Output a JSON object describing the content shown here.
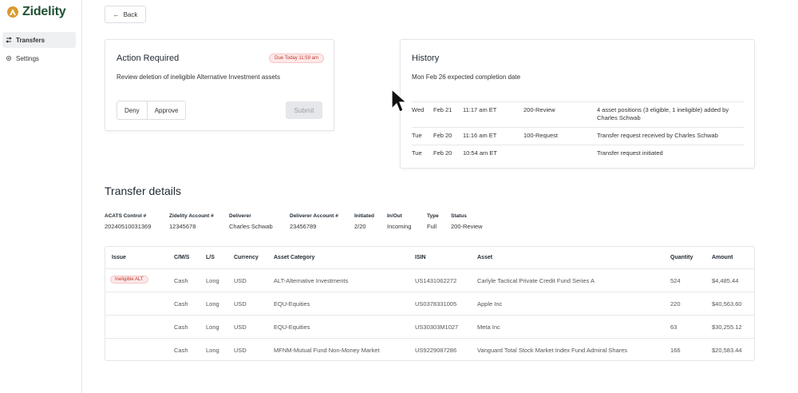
{
  "brand": {
    "name": "Zidelity",
    "color": "#1f5132",
    "accent": "#d99a2b"
  },
  "sidebar": {
    "items": [
      {
        "label": "Transfers",
        "icon": "transfers-icon",
        "active": true
      },
      {
        "label": "Settings",
        "icon": "gear-icon",
        "active": false
      }
    ]
  },
  "back": {
    "label": "Back"
  },
  "action": {
    "title": "Action Required",
    "due": "Due Today 11:59 am",
    "description": "Review deletion of ineligible Alternative Investment assets",
    "deny": "Deny",
    "approve": "Approve",
    "submit": "Submit"
  },
  "history": {
    "title": "History",
    "subtitle": "Mon Feb 26 expected completion date",
    "rows": [
      {
        "day": "Wed",
        "date": "Feb 21",
        "time": "11:17 am ET",
        "status": "200-Review",
        "desc": "4 asset positions (3 eligible, 1 ineligible) added by Charles Schwab"
      },
      {
        "day": "Tue",
        "date": "Feb 20",
        "time": "11:16 am ET",
        "status": "100-Request",
        "desc": "Transfer request received by Charles Schwab"
      },
      {
        "day": "Tue",
        "date": "Feb 20",
        "time": "10:54 am ET",
        "status": "",
        "desc": "Transfer request initiated"
      }
    ]
  },
  "details": {
    "title": "Transfer details",
    "fields": [
      {
        "key": "ACATS Control #",
        "value": "2024051003136​9"
      },
      {
        "key": "Zidelity Account #",
        "value": "12345678"
      },
      {
        "key": "Deliverer",
        "value": "Charles Schwab"
      },
      {
        "key": "Deliverer Account #",
        "value": "23456789"
      },
      {
        "key": "Initiated",
        "value": "2/20"
      },
      {
        "key": "In/Out",
        "value": "Incoming"
      },
      {
        "key": "Type",
        "value": "Full"
      },
      {
        "key": "Status",
        "value": "200-Review"
      }
    ]
  },
  "assets": {
    "headers": [
      "Issue",
      "C/M/S",
      "L/S",
      "Currency",
      "Asset Category",
      "ISIN",
      "Asset",
      "Quantity",
      "Amount"
    ],
    "rows": [
      {
        "issue": "Ineligible ALT",
        "cms": "Cash",
        "ls": "Long",
        "currency": "USD",
        "category": "ALT-Alternative Investments",
        "isin": "US1431062272",
        "asset": "Carlyle Tactical Private Credit Fund Series A",
        "quantity": "524",
        "amount": "$4,485.44"
      },
      {
        "issue": "",
        "cms": "Cash",
        "ls": "Long",
        "currency": "USD",
        "category": "EQU-Equities",
        "isin": "US0378331005",
        "asset": "Apple Inc",
        "quantity": "220",
        "amount": "$40,563.60"
      },
      {
        "issue": "",
        "cms": "Cash",
        "ls": "Long",
        "currency": "USD",
        "category": "EQU-Equities",
        "isin": "US30303M1027",
        "asset": "Meta Inc",
        "quantity": "63",
        "amount": "$30,255.12"
      },
      {
        "issue": "",
        "cms": "Cash",
        "ls": "Long",
        "currency": "USD",
        "category": "MFNM-Mutual Fund Non-Money Market",
        "isin": "US9229087286",
        "asset": "Vanguard Total Stock Market Index Fund Admiral Shares",
        "quantity": "166",
        "amount": "$20,583.44"
      }
    ]
  }
}
